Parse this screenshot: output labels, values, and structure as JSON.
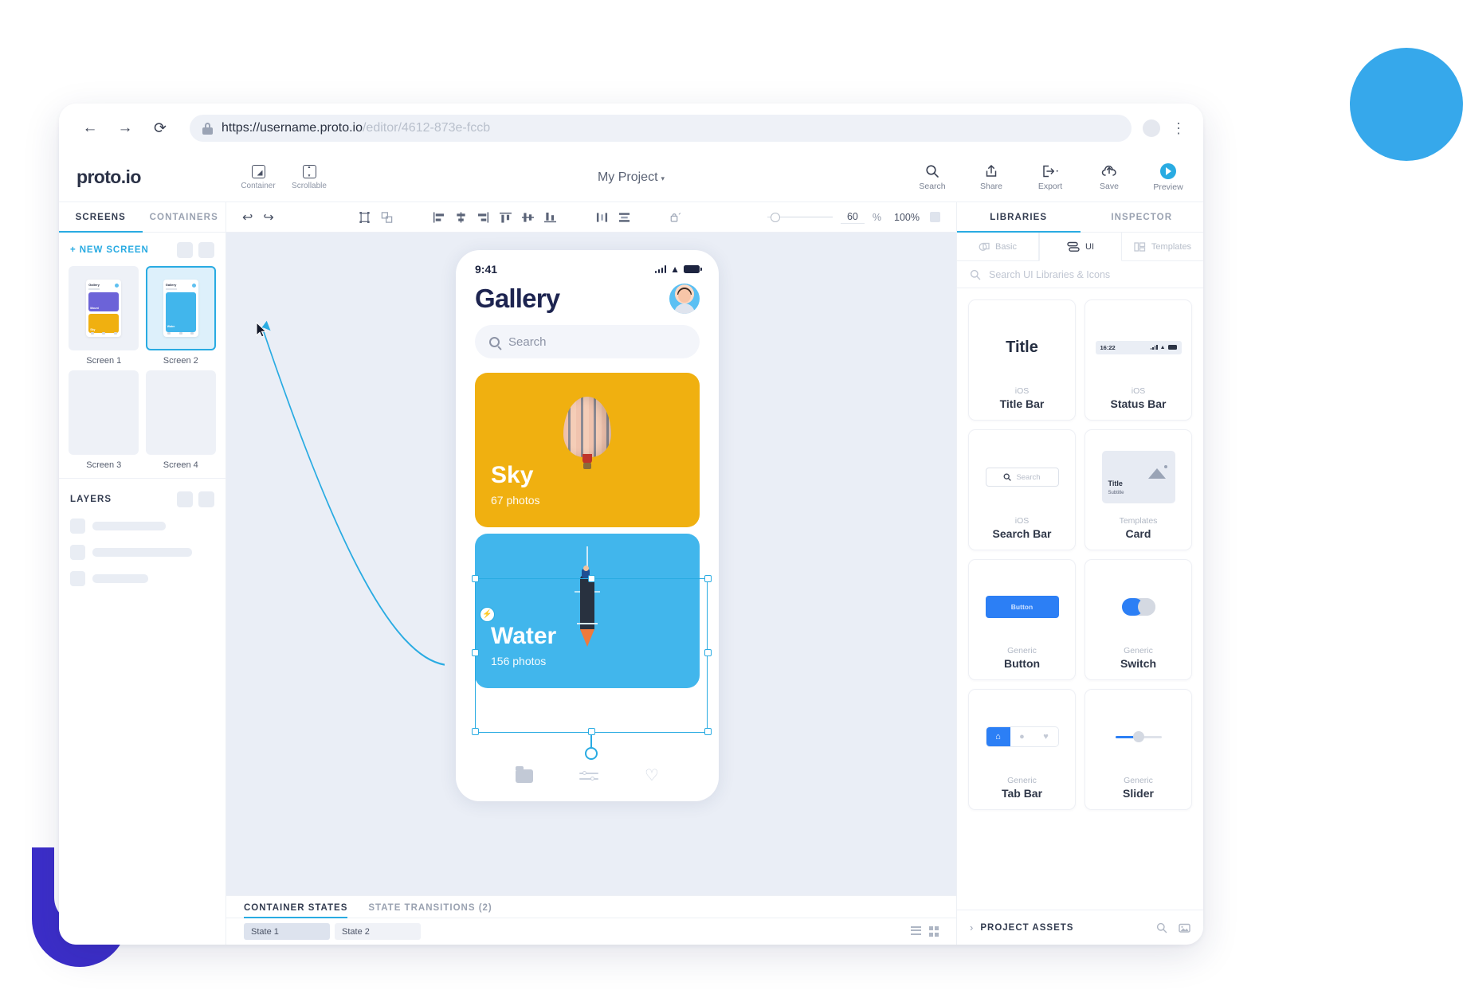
{
  "browser": {
    "back_icon": "arrow-left-icon",
    "forward_icon": "arrow-right-icon",
    "reload_icon": "reload-icon",
    "url_secure": "https://username.proto.io",
    "url_dim": "/editor/4612-873e-fccb",
    "menu_icon": "kebab-menu-icon"
  },
  "header": {
    "logo": "proto.io",
    "tools": [
      {
        "label": "Container",
        "icon": "container-icon"
      },
      {
        "label": "Scrollable",
        "icon": "scrollable-icon"
      }
    ],
    "project_title": "My Project",
    "project_caret": "▾",
    "right_tools": [
      {
        "label": "Search",
        "icon": "search-icon"
      },
      {
        "label": "Share",
        "icon": "share-icon"
      },
      {
        "label": "Export",
        "icon": "export-icon"
      },
      {
        "label": "Save",
        "icon": "cloud-save-icon"
      },
      {
        "label": "Preview",
        "icon": "play-icon"
      }
    ]
  },
  "left_panel": {
    "tabs": [
      {
        "label": "SCREENS",
        "active": true
      },
      {
        "label": "CONTAINERS",
        "active": false
      }
    ],
    "new_screen_label": "+ NEW SCREEN",
    "screens": [
      {
        "name": "Screen 1",
        "selected": false
      },
      {
        "name": "Screen 2",
        "selected": true
      },
      {
        "name": "Screen 3",
        "selected": false
      },
      {
        "name": "Screen 4",
        "selected": false
      }
    ],
    "screen1_preview": {
      "title": "Gallery",
      "cards": [
        {
          "label": "Mount",
          "color": "#6c63d8"
        },
        {
          "label": "Sky",
          "color": "#f0b010"
        }
      ]
    },
    "screen2_preview": {
      "title": "Gallery",
      "cards": [
        {
          "label": "Water",
          "color": "#41b6ec"
        }
      ]
    },
    "layers_title": "LAYERS"
  },
  "toolbar": {
    "undo_icon": "undo-icon",
    "redo_icon": "redo-icon",
    "align_icons": [
      "transform-icon",
      "distribute-icon",
      "align-left-icon",
      "align-center-h-icon",
      "align-right-icon",
      "align-top-icon",
      "align-middle-icon",
      "align-bottom-icon",
      "distribute-h-icon",
      "distribute-v-icon",
      "lock-icon"
    ],
    "opacity_value": "60",
    "opacity_unit": "%",
    "zoom_value": "100%",
    "fit_icon": "fit-to-screen-icon"
  },
  "phone": {
    "status_time": "9:41",
    "signal_icon": "cellular-icon",
    "wifi_icon": "wifi-icon",
    "battery_icon": "battery-icon",
    "title": "Gallery",
    "avatar": "user-avatar",
    "search_placeholder": "Search",
    "cards": [
      {
        "title": "Sky",
        "subtitle": "67 photos",
        "color": "#f0b010",
        "image": "hot-air-balloon",
        "selected": false
      },
      {
        "title": "Water",
        "subtitle": "156 photos",
        "color": "#41b6ec",
        "image": "sailboat",
        "selected": true
      }
    ],
    "tabbar": [
      {
        "icon": "folder-icon"
      },
      {
        "icon": "sliders-icon"
      },
      {
        "icon": "heart-icon"
      }
    ]
  },
  "states_panel": {
    "tabs": [
      {
        "label": "CONTAINER STATES",
        "active": true
      },
      {
        "label": "STATE TRANSITIONS (2)",
        "active": false
      }
    ],
    "states": [
      {
        "label": "State 1",
        "active": true
      },
      {
        "label": "State 2",
        "active": false
      }
    ],
    "view_list_icon": "list-view-icon",
    "view_grid_icon": "grid-view-icon"
  },
  "right_panel": {
    "tabs": [
      {
        "label": "LIBRARIES",
        "active": true
      },
      {
        "label": "INSPECTOR",
        "active": false
      }
    ],
    "sub_tabs": [
      {
        "label": "Basic",
        "icon": "basic-shapes-icon",
        "active": false
      },
      {
        "label": "UI",
        "icon": "ui-components-icon",
        "active": true
      },
      {
        "label": "Templates",
        "icon": "templates-icon",
        "active": false
      }
    ],
    "search_placeholder": "Search UI Libraries & Icons",
    "items": [
      {
        "category": "iOS",
        "name": "Title Bar",
        "preview": "title-text",
        "preview_text": "Title"
      },
      {
        "category": "iOS",
        "name": "Status Bar",
        "preview": "status-bar",
        "preview_text": "16:22"
      },
      {
        "category": "iOS",
        "name": "Search Bar",
        "preview": "search-bar",
        "preview_text": "Search"
      },
      {
        "category": "Templates",
        "name": "Card",
        "preview": "card",
        "preview_text": "Title",
        "preview_subtext": "Subtitle"
      },
      {
        "category": "Generic",
        "name": "Button",
        "preview": "button",
        "preview_text": "Button"
      },
      {
        "category": "Generic",
        "name": "Switch",
        "preview": "switch"
      },
      {
        "category": "Generic",
        "name": "Tab Bar",
        "preview": "tab-bar"
      },
      {
        "category": "Generic",
        "name": "Slider",
        "preview": "slider"
      }
    ],
    "assets_title": "PROJECT ASSETS",
    "assets_chevron": "›",
    "assets_search_icon": "search-icon",
    "assets_image_icon": "image-icon"
  },
  "colors": {
    "accent": "#29ABE2",
    "sky_card": "#f0b010",
    "water_card": "#41b6ec",
    "blue_blob": "#36a8eb",
    "purple_blob": "#3c2ec9"
  }
}
